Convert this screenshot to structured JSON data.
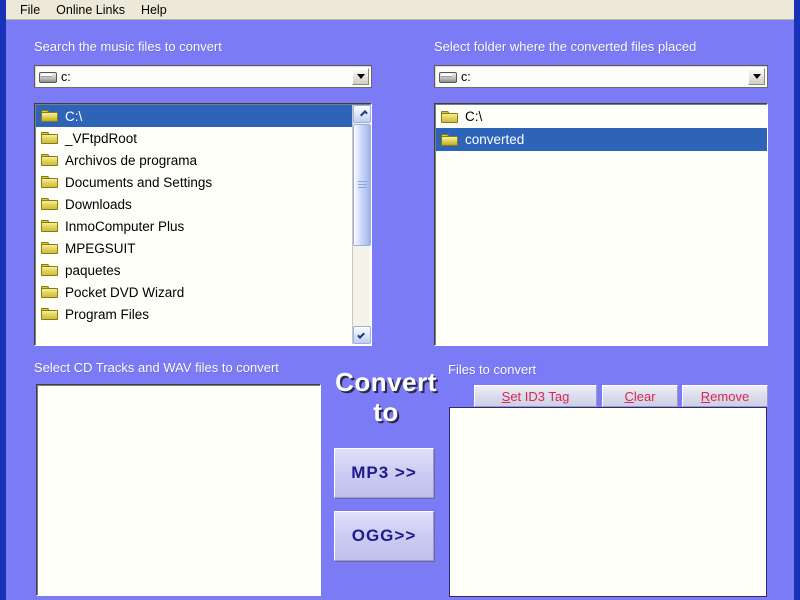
{
  "app": {
    "background_color": "#7b7bf5",
    "border_color": "#1633b8",
    "selection_color": "#2e64b8",
    "button_text_color": "#d6294f",
    "convert_button_text_color": "#1c1c8e"
  },
  "menubar": {
    "items": [
      {
        "label": "File"
      },
      {
        "label": "Online Links"
      },
      {
        "label": "Help"
      }
    ]
  },
  "source_panel": {
    "label": "Search the music files to convert",
    "drive_combo": {
      "value": "c:",
      "icon": "drive-icon",
      "arrow_icon": "chevron-down-icon"
    },
    "folders": [
      {
        "name": "C:\\",
        "selected": true
      },
      {
        "name": "_VFtpdRoot",
        "selected": false
      },
      {
        "name": "Archivos de programa",
        "selected": false
      },
      {
        "name": "Documents and Settings",
        "selected": false
      },
      {
        "name": "Downloads",
        "selected": false
      },
      {
        "name": "InmoComputer Plus",
        "selected": false
      },
      {
        "name": "MPEGSUIT",
        "selected": false
      },
      {
        "name": "paquetes",
        "selected": false
      },
      {
        "name": "Pocket DVD Wizard",
        "selected": false
      },
      {
        "name": "Program Files",
        "selected": false
      }
    ],
    "scrollbar": {
      "up_icon": "chevron-up-icon",
      "down_icon": "chevron-down-icon"
    }
  },
  "dest_panel": {
    "label": "Select folder where the converted files placed",
    "drive_combo": {
      "value": "c:",
      "icon": "drive-icon",
      "arrow_icon": "chevron-down-icon"
    },
    "folders": [
      {
        "name": "C:\\",
        "selected": false
      },
      {
        "name": "converted",
        "selected": true
      }
    ]
  },
  "tracks_panel": {
    "label": "Select CD Tracks and WAV files to convert",
    "items": []
  },
  "convert_panel": {
    "title_line1": "Convert",
    "title_line2": "to",
    "mp3_button": "MP3  >>",
    "ogg_button": "OGG>>"
  },
  "files_panel": {
    "label": "Files to convert",
    "toolbar": [
      {
        "accel": "S",
        "rest": "et ID3 Tag",
        "name": "set-id3-tag-button"
      },
      {
        "accel": "C",
        "rest": "lear",
        "name": "clear-button"
      },
      {
        "accel": "R",
        "rest": "emove",
        "name": "remove-button"
      }
    ],
    "items": []
  }
}
